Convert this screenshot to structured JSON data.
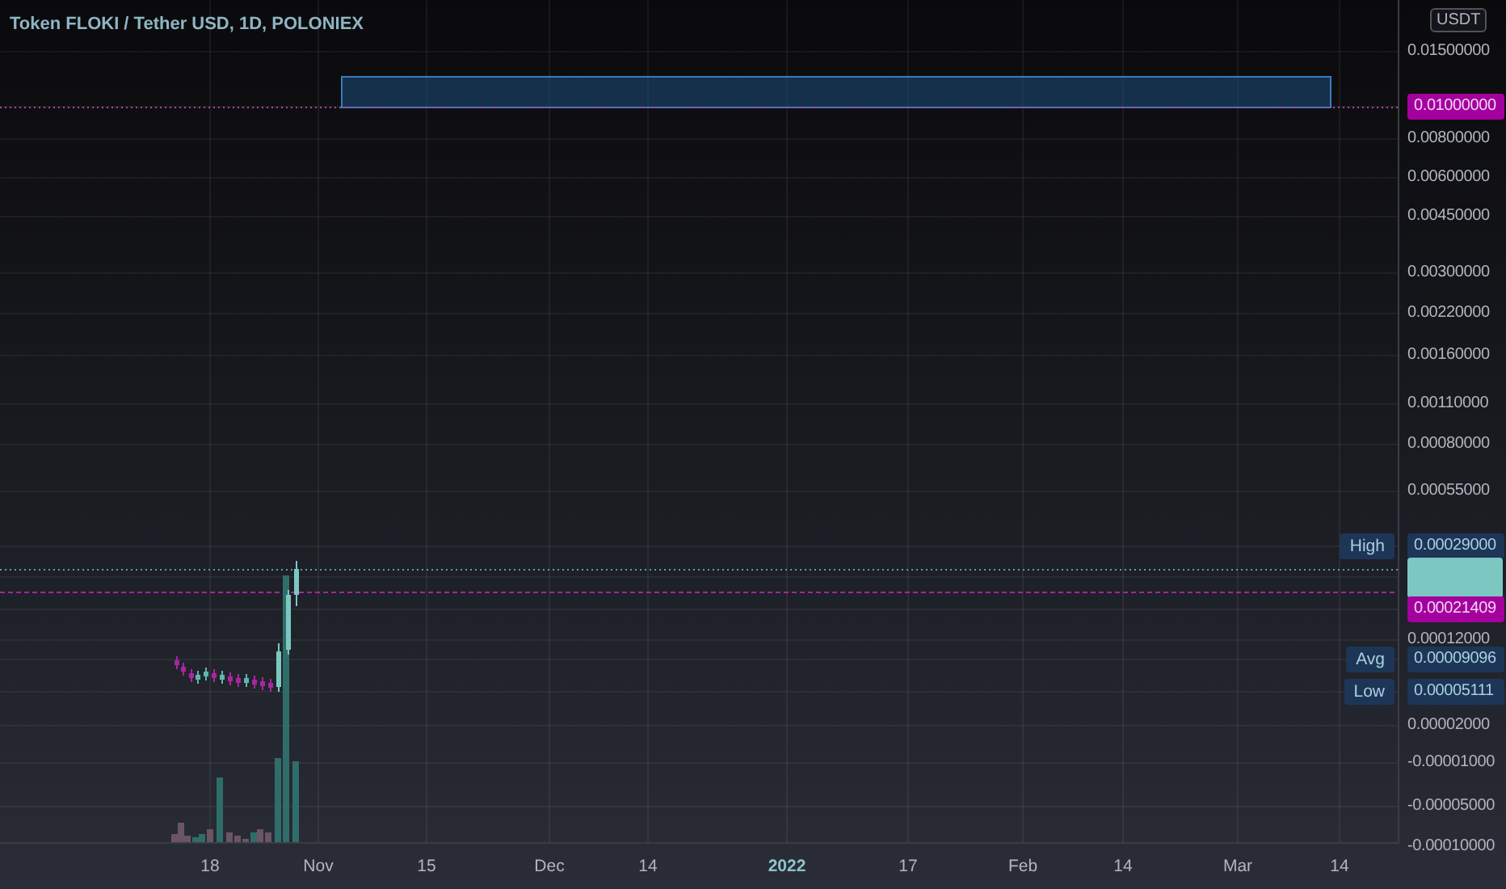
{
  "title": "Token FLOKI / Tether USD, 1D, POLONIEX",
  "currency": "USDT",
  "price_axis": [
    {
      "kind": "tick",
      "value": "0.01500000"
    },
    {
      "kind": "marker",
      "value": "0.01000000"
    },
    {
      "kind": "tick",
      "value": "0.00800000"
    },
    {
      "kind": "tick",
      "value": "0.00600000"
    },
    {
      "kind": "tick",
      "value": "0.00450000"
    },
    {
      "kind": "tick",
      "value": "0.00300000"
    },
    {
      "kind": "tick",
      "value": "0.00220000"
    },
    {
      "kind": "tick",
      "value": "0.00160000"
    },
    {
      "kind": "tick",
      "value": "0.00110000"
    },
    {
      "kind": "tick",
      "value": "0.00080000"
    },
    {
      "kind": "tick",
      "value": "0.00055000"
    },
    {
      "kind": "tagged",
      "tag": "High",
      "value": "0.00029000"
    },
    {
      "kind": "current"
    },
    {
      "kind": "marker",
      "value": "0.00021409"
    },
    {
      "kind": "tick",
      "value": "0.00012000"
    },
    {
      "kind": "tagged",
      "tag": "Avg",
      "value": "0.00009096"
    },
    {
      "kind": "tagged",
      "tag": "Low",
      "value": "0.00005111"
    },
    {
      "kind": "tick",
      "value": "0.00002000"
    },
    {
      "kind": "tick",
      "value": "-0.00001000"
    },
    {
      "kind": "tick",
      "value": "-0.00005000"
    },
    {
      "kind": "tick",
      "value": "-0.00010000"
    }
  ],
  "time_axis": [
    {
      "kind": "day",
      "label": "18"
    },
    {
      "kind": "month",
      "label": "Nov"
    },
    {
      "kind": "day",
      "label": "15"
    },
    {
      "kind": "month",
      "label": "Dec"
    },
    {
      "kind": "day",
      "label": "14"
    },
    {
      "kind": "year",
      "label": "2022"
    },
    {
      "kind": "day",
      "label": "17"
    },
    {
      "kind": "month",
      "label": "Feb"
    },
    {
      "kind": "day",
      "label": "14"
    },
    {
      "kind": "month",
      "label": "Mar"
    },
    {
      "kind": "day",
      "label": "14"
    }
  ]
}
